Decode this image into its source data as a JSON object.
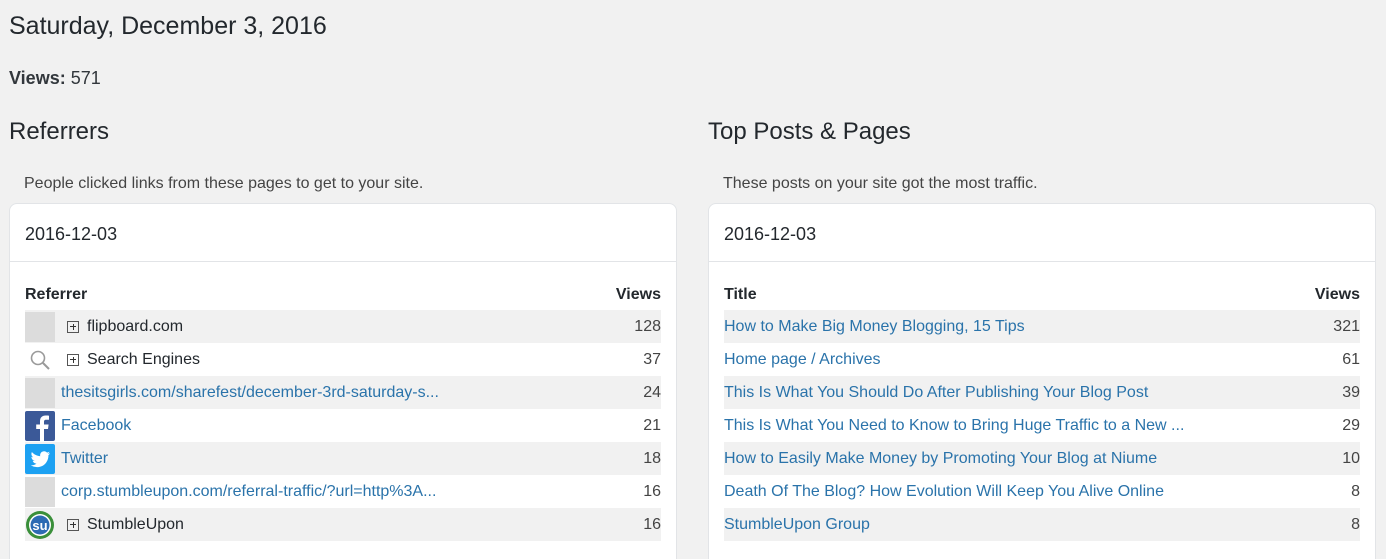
{
  "page": {
    "title": "Saturday, December 3, 2016",
    "views_label": "Views:",
    "views_value": "571"
  },
  "referrers": {
    "title": "Referrers",
    "description": "People clicked links from these pages to get to your site.",
    "date": "2016-12-03",
    "col_referrer": "Referrer",
    "col_views": "Views",
    "rows": [
      {
        "label": "flipboard.com",
        "views": "128",
        "icon": "blank-icon",
        "expandable": true,
        "link": false
      },
      {
        "label": "Search Engines",
        "views": "37",
        "icon": "search-icon",
        "expandable": true,
        "link": false
      },
      {
        "label": "thesitsgirls.com/sharefest/december-3rd-saturday-s...",
        "views": "24",
        "icon": "blank-icon",
        "expandable": false,
        "link": true
      },
      {
        "label": "Facebook",
        "views": "21",
        "icon": "facebook-icon",
        "expandable": false,
        "link": true
      },
      {
        "label": "Twitter",
        "views": "18",
        "icon": "twitter-icon",
        "expandable": false,
        "link": true
      },
      {
        "label": "corp.stumbleupon.com/referral-traffic/?url=http%3A...",
        "views": "16",
        "icon": "blank-icon",
        "expandable": false,
        "link": true
      },
      {
        "label": "StumbleUpon",
        "views": "16",
        "icon": "stumbleupon-icon",
        "expandable": true,
        "link": false
      }
    ]
  },
  "top_posts": {
    "title": "Top Posts & Pages",
    "description": "These posts on your site got the most traffic.",
    "date": "2016-12-03",
    "col_title": "Title",
    "col_views": "Views",
    "rows": [
      {
        "label": "How to Make Big Money Blogging, 15 Tips",
        "views": "321"
      },
      {
        "label": "Home page / Archives",
        "views": "61"
      },
      {
        "label": "This Is What You Should Do After Publishing Your Blog Post",
        "views": "39"
      },
      {
        "label": "This Is What You Need to Know to Bring Huge Traffic to a New ...",
        "views": "29"
      },
      {
        "label": "How to Easily Make Money by Promoting Your Blog at Niume",
        "views": "10"
      },
      {
        "label": "Death Of The Blog? How Evolution Will Keep You Alive Online",
        "views": "8"
      },
      {
        "label": "StumbleUpon Group",
        "views": "8"
      }
    ]
  },
  "colors": {
    "link": "#2a73aa",
    "background": "#f1f1f1",
    "facebook": "#3b5998",
    "twitter": "#1da1f2",
    "stumbleupon": "#3a8f3a"
  }
}
